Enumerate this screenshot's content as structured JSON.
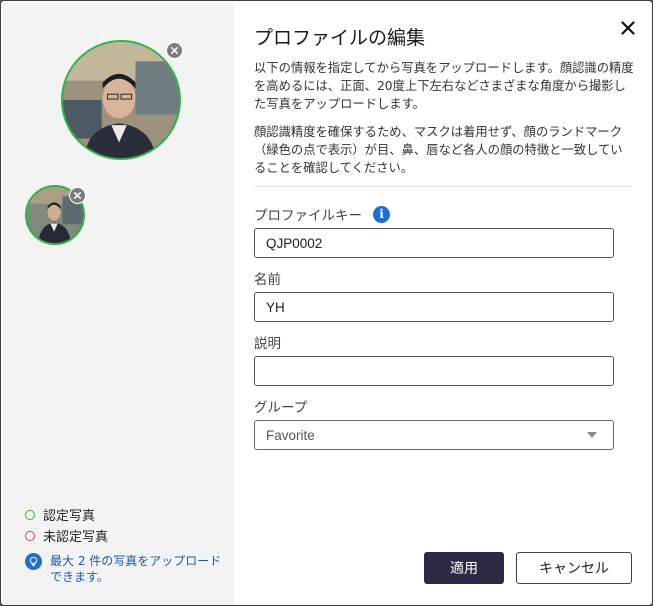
{
  "dialog": {
    "title": "プロファイルの編集",
    "description_1": "以下の情報を指定してから写真をアップロードします。顔認識の精度を高めるには、正面、20度上下左右などさまざまな角度から撮影した写真をアップロードします。",
    "description_2": "顔認識精度を確保するため、マスクは着用せず、顔のランドマーク（緑色の点で表示）が目、鼻、唇など各人の顔の特徴と一致していることを確認してください。"
  },
  "form": {
    "profile_key_label": "プロファイルキー",
    "profile_key_value": "QJP0002",
    "name_label": "名前",
    "name_value": "YH",
    "description_label": "説明",
    "description_value": "",
    "group_label": "グループ",
    "group_value": "Favorite"
  },
  "sidebar": {
    "legend_certified": "認定写真",
    "legend_uncertified": "未認定写真",
    "hint": "最大 2 件の写真をアップロードできます。"
  },
  "buttons": {
    "apply": "適用",
    "cancel": "キャンセル"
  },
  "colors": {
    "certified": "#2fb34a",
    "uncertified": "#e0454a",
    "primary_button": "#2c2a44",
    "info_blue": "#1e6fd0"
  },
  "icons": {
    "close": "close-icon",
    "remove_photo": "remove-photo-icon",
    "info": "info-icon",
    "hint": "lightbulb-icon",
    "dropdown": "chevron-down-icon"
  }
}
